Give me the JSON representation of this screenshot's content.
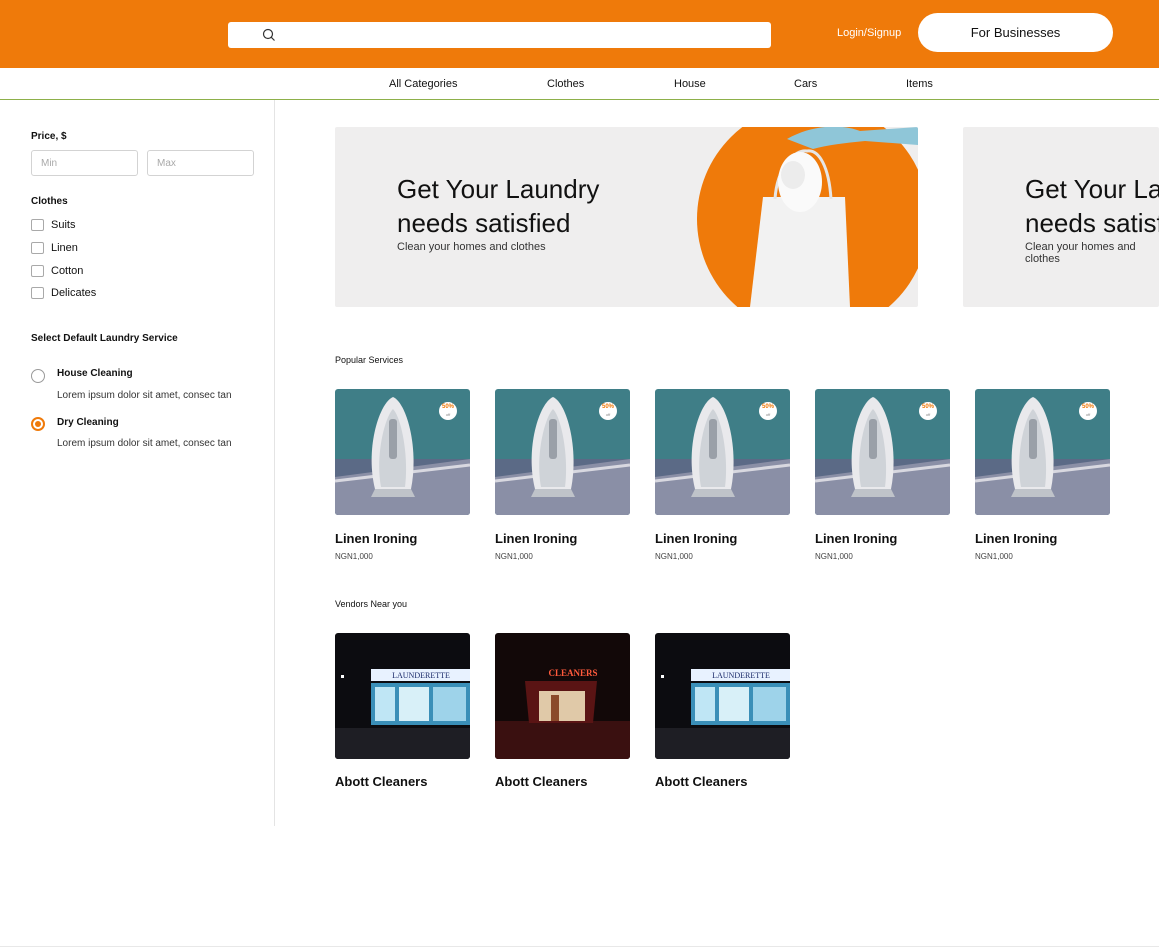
{
  "header": {
    "search_placeholder": "",
    "login_label": "Login/Signup",
    "business_button": "For Businesses"
  },
  "categories": [
    "All Categories",
    "Clothes",
    "House",
    "Cars",
    "Items"
  ],
  "filters": {
    "price_label": "Price, $",
    "min_placeholder": "Min",
    "max_placeholder": "Max",
    "clothes_label": "Clothes",
    "clothes_options": [
      "Suits",
      "Linen",
      "Cotton",
      "Delicates"
    ],
    "service_label": "Select Default Laundry Service",
    "services": [
      {
        "title": "House Cleaning",
        "description": "Lorem ipsum dolor sit amet, consec tan",
        "selected": false
      },
      {
        "title": "Dry Cleaning",
        "description": "Lorem ipsum dolor sit amet, consec tan",
        "selected": true
      }
    ]
  },
  "banners": [
    {
      "title": "Get Your Laundry needs satisfied",
      "subtitle": "Clean your homes and clothes"
    },
    {
      "title": "Get Your Laundry needs satisfied",
      "subtitle": "Clean your homes and clothes"
    }
  ],
  "popular": {
    "title": "Popular Services",
    "items": [
      {
        "name": "Linen Ironing",
        "price": "NGN1,000",
        "badge": "50%",
        "badge_sub": "off"
      },
      {
        "name": "Linen Ironing",
        "price": "NGN1,000",
        "badge": "50%",
        "badge_sub": "off"
      },
      {
        "name": "Linen Ironing",
        "price": "NGN1,000",
        "badge": "50%",
        "badge_sub": "off"
      },
      {
        "name": "Linen Ironing",
        "price": "NGN1,000",
        "badge": "50%",
        "badge_sub": "off"
      },
      {
        "name": "Linen Ironing",
        "price": "NGN1,000",
        "badge": "50%",
        "badge_sub": "off"
      }
    ]
  },
  "vendors": {
    "title": "Vendors Near you",
    "items": [
      {
        "name": "Abott Cleaners",
        "sign": "LAUNDERETTE"
      },
      {
        "name": "Abott Cleaners",
        "sign": "CLEANERS"
      },
      {
        "name": "Abott Cleaners",
        "sign": "LAUNDERETTE"
      }
    ]
  },
  "colors": {
    "brand": "#ef7a0a",
    "nav_rule": "#8db04a"
  }
}
